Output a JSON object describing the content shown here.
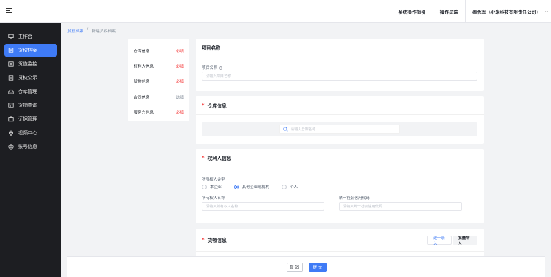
{
  "topbar": {
    "guide": "系统操作指引",
    "role": "操作员端",
    "user": "奉代军（小米科技有限责任公司）"
  },
  "sidebar": {
    "items": [
      {
        "label": "工作台",
        "icon": "desktop-icon",
        "active": false
      },
      {
        "label": "货权档案",
        "icon": "archive-icon",
        "active": true
      },
      {
        "label": "货值监控",
        "icon": "value-icon",
        "active": false
      },
      {
        "label": "货权公示",
        "icon": "notice-icon",
        "active": false
      },
      {
        "label": "仓库管理",
        "icon": "warehouse-icon",
        "active": false
      },
      {
        "label": "货物查询",
        "icon": "goods-search-icon",
        "active": false
      },
      {
        "label": "证据管理",
        "icon": "evidence-icon",
        "active": false
      },
      {
        "label": "视频中心",
        "icon": "video-icon",
        "active": false
      },
      {
        "label": "账号信息",
        "icon": "account-icon",
        "active": false
      }
    ]
  },
  "breadcrumb": {
    "root": "货权档案",
    "separator": "/",
    "current": "新建货权档案"
  },
  "steps": [
    {
      "label": "仓库信息",
      "tag": "必填",
      "required": true
    },
    {
      "label": "权利人信息",
      "tag": "必填",
      "required": true
    },
    {
      "label": "货物信息",
      "tag": "必填",
      "required": true
    },
    {
      "label": "合同信息",
      "tag": "选填",
      "required": false
    },
    {
      "label": "服务方信息",
      "tag": "必填",
      "required": true
    }
  ],
  "project": {
    "title": "项目名称",
    "field_label": "项目名称",
    "help": "?",
    "placeholder": "请输入项目名称"
  },
  "warehouse": {
    "star": "*",
    "title": "仓库信息",
    "search_placeholder": "请输入仓库名称"
  },
  "owner": {
    "star": "*",
    "title": "权利人信息",
    "type_label": "所有权人类型",
    "types": [
      {
        "label": "本企业",
        "selected": false
      },
      {
        "label": "其他企业或机构",
        "selected": true
      },
      {
        "label": "个人",
        "selected": false
      }
    ],
    "name_label": "所有权人名称",
    "name_placeholder": "请输入所有权人名称",
    "code_label": "统一社会信用代码",
    "code_placeholder": "请输入统一社会信用代码"
  },
  "goods": {
    "star": "*",
    "title": "货物信息",
    "add_one": "逐一录入",
    "batch_import": "批量导入"
  },
  "footer": {
    "cancel": "取 消",
    "submit": "提 交"
  },
  "colors": {
    "primary": "#3f7bf6",
    "required": "#f53f3f",
    "sidebar_bg": "#1d1e22"
  }
}
